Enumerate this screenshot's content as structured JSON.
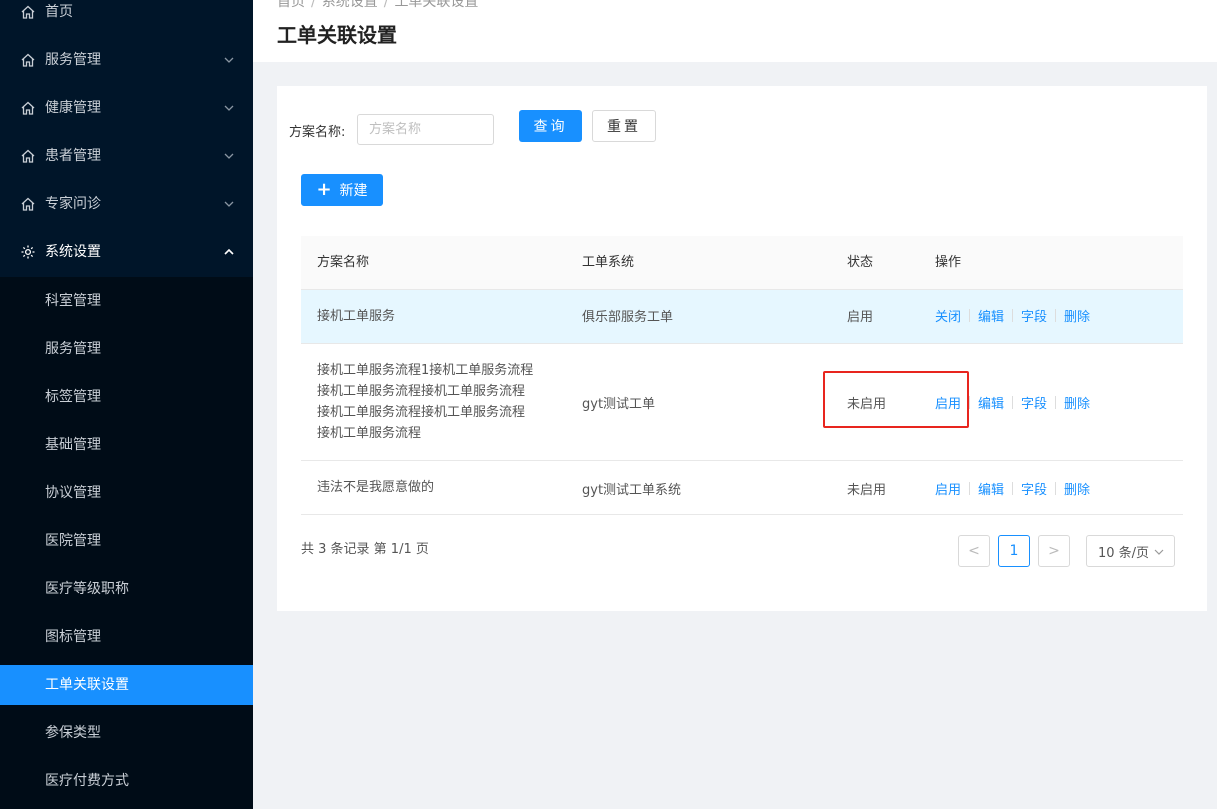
{
  "sidebar": {
    "items": [
      {
        "label": "首页",
        "icon": "home-icon"
      },
      {
        "label": "服务管理",
        "icon": "home-icon"
      },
      {
        "label": "健康管理",
        "icon": "home-icon"
      },
      {
        "label": "患者管理",
        "icon": "home-icon"
      },
      {
        "label": "专家问诊",
        "icon": "home-icon"
      },
      {
        "label": "系统设置",
        "icon": "gear-icon"
      }
    ],
    "submenu": [
      {
        "label": "科室管理"
      },
      {
        "label": "服务管理"
      },
      {
        "label": "标签管理"
      },
      {
        "label": "基础管理"
      },
      {
        "label": "协议管理"
      },
      {
        "label": "医院管理"
      },
      {
        "label": "医疗等级职称"
      },
      {
        "label": "图标管理"
      },
      {
        "label": "工单关联设置"
      },
      {
        "label": "参保类型"
      },
      {
        "label": "医疗付费方式"
      }
    ]
  },
  "header": {
    "breadcrumb": [
      "首页",
      "系统设置",
      "工单关联设置"
    ],
    "title": "工单关联设置"
  },
  "filter": {
    "label": "方案名称:",
    "placeholder": "方案名称",
    "query_label": "查询",
    "reset_label": "重置"
  },
  "new_button_label": "新建",
  "table": {
    "columns": [
      "方案名称",
      "工单系统",
      "状态",
      "操作"
    ],
    "rows": [
      {
        "name_lines": [
          "接机工单服务"
        ],
        "system": "俱乐部服务工单",
        "status": "启用",
        "ops": [
          "关闭",
          "编辑",
          "字段",
          "删除"
        ]
      },
      {
        "name_lines": [
          "接机工单服务流程1接机工单服务流程",
          "接机工单服务流程接机工单服务流程",
          "接机工单服务流程接机工单服务流程",
          "接机工单服务流程"
        ],
        "system": "gyt测试工单",
        "status": "未启用",
        "ops": [
          "启用",
          "编辑",
          "字段",
          "删除"
        ]
      },
      {
        "name_lines": [
          "违法不是我愿意做的"
        ],
        "system": "gyt测试工单系统",
        "status": "未启用",
        "ops": [
          "启用",
          "编辑",
          "字段",
          "删除"
        ]
      }
    ]
  },
  "pagination": {
    "total_text": "共 3 条记录 第 1/1 页",
    "prev": "<",
    "current_page": "1",
    "next": ">",
    "page_size": "10 条/页"
  },
  "colors": {
    "sidebar_bg": "#001529",
    "primary": "#1890ff",
    "highlight_row": "#e6f7ff",
    "annotation_red": "#e8251e"
  }
}
